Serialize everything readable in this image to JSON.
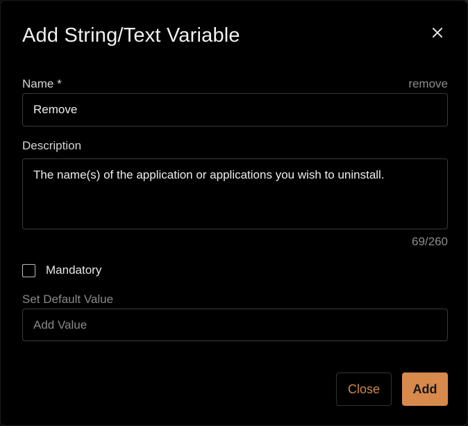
{
  "dialog": {
    "title": "Add String/Text Variable",
    "close_icon": "close-icon"
  },
  "name_field": {
    "label": "Name *",
    "value": "Remove",
    "remove_link": "remove"
  },
  "description_field": {
    "label": "Description",
    "value": "The name(s) of the application or applications you wish to uninstall.",
    "counter": "69/260"
  },
  "mandatory": {
    "label": "Mandatory",
    "checked": false
  },
  "default_value": {
    "label": "Set Default Value",
    "placeholder": "Add Value"
  },
  "footer": {
    "close_label": "Close",
    "add_label": "Add"
  },
  "colors": {
    "accent": "#d88a4c",
    "background": "#000000",
    "border": "#3c3c3c"
  }
}
